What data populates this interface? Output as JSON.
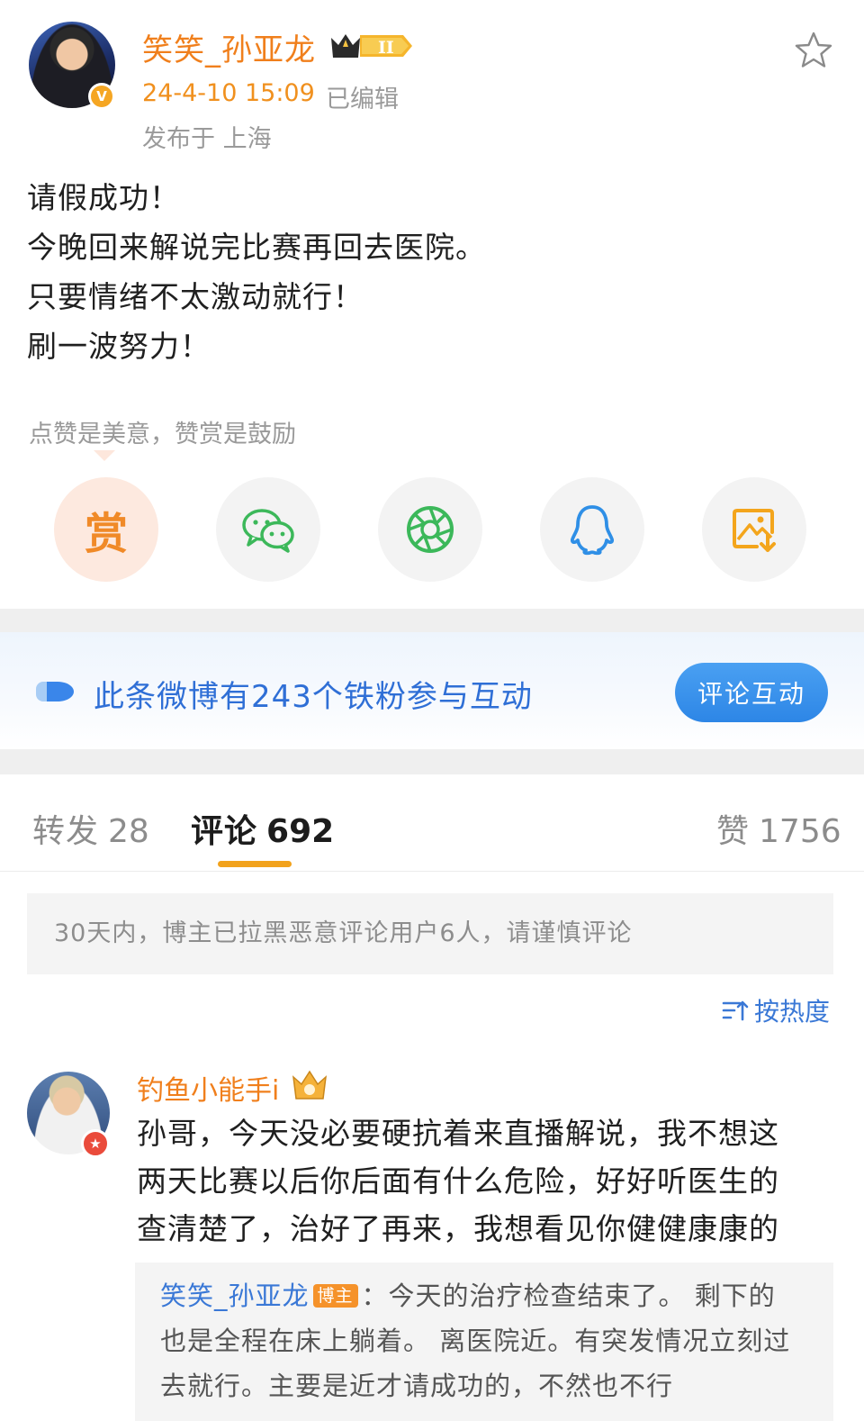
{
  "post": {
    "author": "笑笑_孙亚龙",
    "level_badge": "II",
    "verified_mark": "V",
    "timestamp": "24-4-10 15:09",
    "edited": "已编辑",
    "location": "发布于 上海",
    "lines": [
      "请假成功！",
      "今晚回来解说完比赛再回去医院。",
      "只要情绪不太激动就行！",
      "刷一波努力！"
    ]
  },
  "reward": {
    "tip": "点赞是美意，赞赏是鼓励",
    "reward_label": "赏",
    "share_icons": [
      "reward-icon",
      "wechat-icon",
      "moments-icon",
      "qq-icon",
      "save-image-icon"
    ]
  },
  "fan_banner": {
    "text": "此条微博有243个铁粉参与互动",
    "button": "评论互动"
  },
  "tabs": [
    {
      "label": "转发",
      "count": "28"
    },
    {
      "label": "评论",
      "count": "692"
    },
    {
      "label": "赞",
      "count": "1756"
    }
  ],
  "notice": "30天内，博主已拉黑恶意评论用户6人，请谨慎评论",
  "sort": {
    "label": "按热度"
  },
  "comment": {
    "author": "钓鱼小能手i",
    "lines": [
      "孙哥，今天没必要硬抗着来直播解说，我不想这",
      "两天比赛以后你后面有什么危险，好好听医生的",
      "查清楚了，治好了再来，我想看见你健健康康的"
    ],
    "reply": {
      "author": "笑笑_孙亚龙",
      "host_tag": "博主",
      "first": "：今天的治疗检查结束了。 剩下的",
      "lines": [
        "也是全程在床上躺着。 离医院近。有突发情况立刻过",
        "去就行。主要是近才请成功的，不然也不行"
      ]
    }
  },
  "colors": {
    "brand_orange": "#f07f1c",
    "link_blue": "#3a78d6",
    "tab_underline": "#f2a21c",
    "banner_button": "#2d86e6"
  }
}
